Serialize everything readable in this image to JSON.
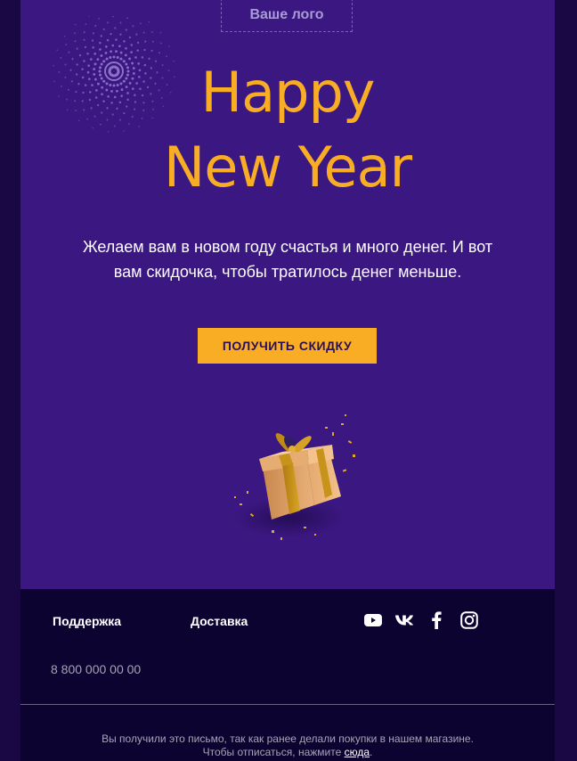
{
  "logo": {
    "text": "Ваше лого"
  },
  "hero": {
    "title_line1": "Happy",
    "title_line2": "New Year",
    "subtitle_line1": "Желаем вам в новом году счастья и много денег. И вот",
    "subtitle_line2": "вам скидочка, чтобы тратилось денег меньше.",
    "button_label": "ПОЛУЧИТЬ СКИДКУ"
  },
  "footer": {
    "support_label": "Поддержка",
    "delivery_label": "Доставка",
    "phone": "8 800 000 00 00",
    "social": [
      "youtube-icon",
      "vk-icon",
      "facebook-icon",
      "instagram-icon"
    ],
    "legal_line1": "Вы получили это письмо, так как ранее делали покупки в нашем магазине.",
    "legal_line2_prefix": "Чтобы отписаться, нажмите ",
    "legal_line2_link": "сюда",
    "legal_line2_suffix": "."
  },
  "colors": {
    "page_background": "#1a0845",
    "hero_background": "#3b1781",
    "footer_background": "#0d0330",
    "accent": "#f9ad25",
    "button_text": "#2b0f5f"
  }
}
